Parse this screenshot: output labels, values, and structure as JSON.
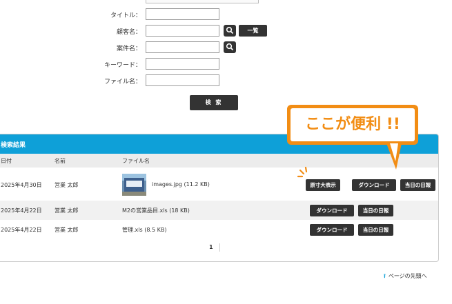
{
  "form": {
    "title_label": "タイトル：",
    "customer_label": "顧客名：",
    "case_label": "案件名：",
    "keyword_label": "キーワード：",
    "filename_label": "ファイル名：",
    "list_button": "一覧",
    "search_button": "検 索"
  },
  "results": {
    "header": "検索結果",
    "columns": [
      "日付",
      "名前",
      "ファイル名"
    ],
    "rows": [
      {
        "date": "2025年4月30日",
        "name": "営業 太郎",
        "file": "images.jpg (11.2 KB)",
        "buttons": [
          "原寸大表示",
          "ダウンロード",
          "当日の日報"
        ]
      },
      {
        "date": "2025年4月22日",
        "name": "営業 太郎",
        "file": "M2の営業品目.xls (18 KB)",
        "buttons": [
          "ダウンロード",
          "当日の日報"
        ]
      },
      {
        "date": "2025年4月22日",
        "name": "営業 太郎",
        "file": "管理.xls (8.5 KB)",
        "buttons": [
          "ダウンロード",
          "当日の日報"
        ]
      }
    ],
    "page": "1"
  },
  "callout": {
    "text": "ここが便利 !!"
  },
  "footer": {
    "page_top": "ページの先頭へ",
    "page_top_icon": "arrow-up-icon"
  },
  "colors": {
    "accent": "#0ea0d8",
    "callout": "#f28d14",
    "button": "#333333"
  }
}
